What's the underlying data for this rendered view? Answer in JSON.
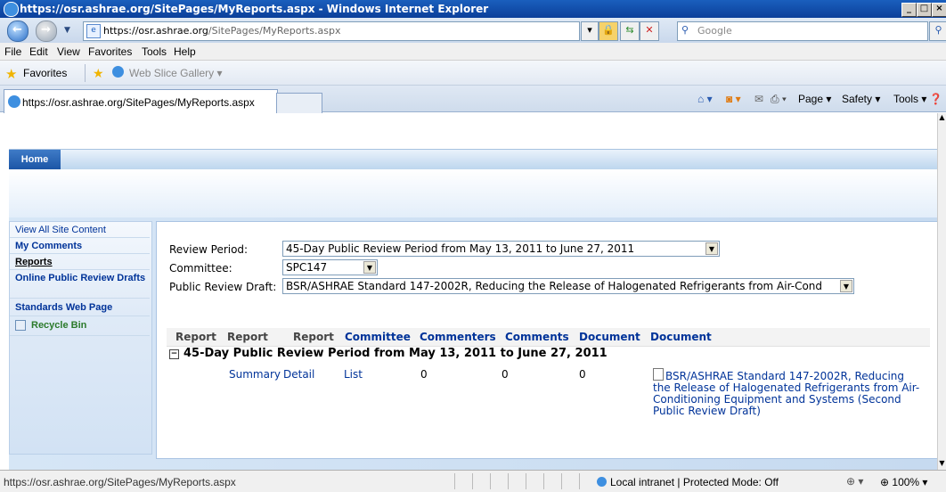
{
  "window": {
    "title": "https://osr.ashrae.org/SitePages/MyReports.aspx - Windows Internet Explorer"
  },
  "address": {
    "url_host": "https://osr.ashrae.org",
    "url_path": "/SitePages/MyReports.aspx",
    "search_placeholder": "Google"
  },
  "menu": [
    "File",
    "Edit",
    "View",
    "Favorites",
    "Tools",
    "Help"
  ],
  "favorites": {
    "label": "Favorites",
    "web_slice": "Web Slice Gallery ▾"
  },
  "tab": {
    "title": "https://osr.ashrae.org/SitePages/MyReports.aspx"
  },
  "commandbar": {
    "page": "Page ▾",
    "safety": "Safety ▾",
    "tools": "Tools ▾"
  },
  "site_nav": {
    "home": "Home"
  },
  "quick_launch": {
    "view_all": "View All Site Content",
    "my_comments": "My Comments",
    "reports": "Reports",
    "online_public_review_drafts": "Online Public Review Drafts",
    "standards_web_page": "Standards Web Page",
    "recycle_bin": "Recycle Bin"
  },
  "filters": {
    "review_period_label": "Review Period:",
    "review_period_value": "45-Day Public Review Period from May 13, 2011 to June 27, 2011",
    "committee_label": "Committee:",
    "committee_value": "SPC147",
    "draft_label": "Public Review Draft:",
    "draft_value": "BSR/ASHRAE Standard 147-2002R, Reducing the Release of Halogenated Refrigerants from Air-Cond"
  },
  "table": {
    "headers": [
      "Report",
      "Report",
      "Report",
      "Committee",
      "Commenters",
      "Comments",
      "Document",
      "Document"
    ],
    "group": "45-Day Public Review Period from May 13, 2011 to June 27, 2011",
    "row": {
      "summary": "Summary",
      "detail": "Detail",
      "list": "List",
      "committee": "0",
      "commenters": "0",
      "comments": "0",
      "document": "BSR/ASHRAE Standard 147-2002R, Reducing the Release of Halogenated Refrigerants from Air-Conditioning Equipment and Systems (Second Public Review Draft)"
    }
  },
  "status": {
    "url": "https://osr.ashrae.org/SitePages/MyReports.aspx",
    "zone": "Local intranet | Protected Mode: Off",
    "zoom": "100%"
  }
}
